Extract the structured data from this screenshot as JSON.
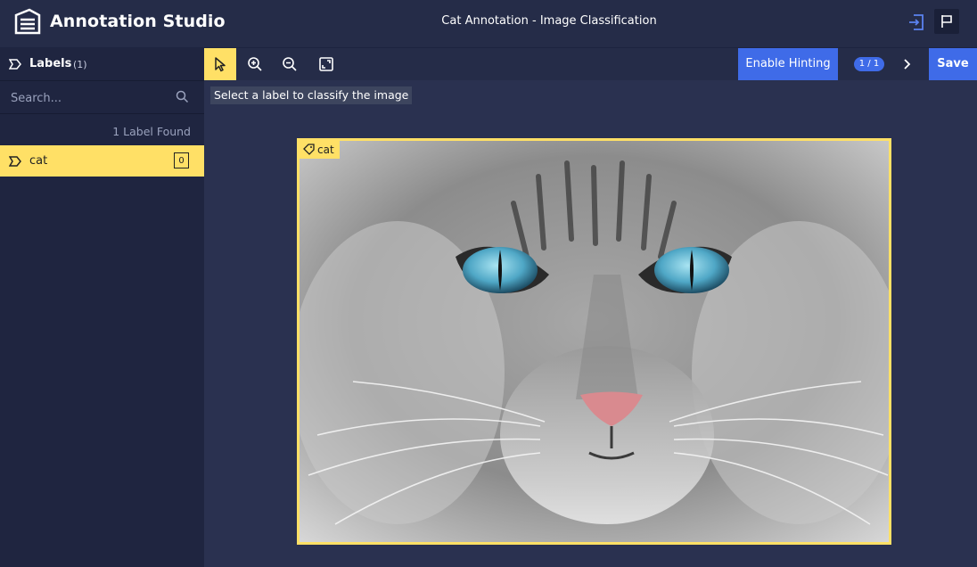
{
  "header": {
    "app_title": "Annotation Studio",
    "document_title": "Cat Annotation - Image Classification",
    "icons": [
      "app-logo-icon",
      "exit-icon",
      "flag-icon"
    ]
  },
  "sidebar": {
    "labels_title": "Labels",
    "labels_count": "(1)",
    "search_placeholder": "Search...",
    "found_text": "1 Label Found",
    "labels": [
      {
        "name": "cat",
        "count": "0",
        "selected": true
      }
    ]
  },
  "toolbar": {
    "tools": [
      "select-tool",
      "zoom-in-tool",
      "zoom-out-tool",
      "fit-screen-tool"
    ],
    "active_tool": "select-tool",
    "hint_label": "Enable Hinting",
    "page_indicator": "1 / 1",
    "save_label": "Save"
  },
  "canvas": {
    "instruction": "Select a label to classify the image",
    "image_tag": "cat",
    "image_subject": "grey long-haired cat with blue eyes"
  },
  "colors": {
    "accent_yellow": "#ffe066",
    "primary_blue": "#3f6be8",
    "background": "#2a3150",
    "sidebar": "#1f2540"
  }
}
